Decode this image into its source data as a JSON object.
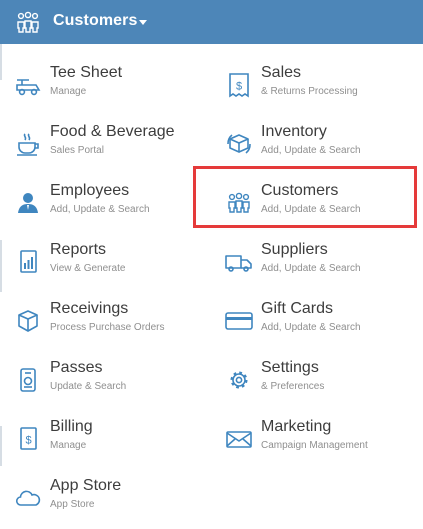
{
  "header": {
    "title": "Customers"
  },
  "menu": {
    "left": [
      {
        "title": "Tee Sheet",
        "subtitle": "Manage",
        "icon": "golf-cart-icon"
      },
      {
        "title": "Food & Beverage",
        "subtitle": "Sales Portal",
        "icon": "coffee-cup-icon"
      },
      {
        "title": "Employees",
        "subtitle": "Add, Update & Search",
        "icon": "employee-icon"
      },
      {
        "title": "Reports",
        "subtitle": "View & Generate",
        "icon": "report-icon"
      },
      {
        "title": "Receivings",
        "subtitle": "Process Purchase Orders",
        "icon": "box-icon"
      },
      {
        "title": "Passes",
        "subtitle": "Update & Search",
        "icon": "pass-icon"
      },
      {
        "title": "Billing",
        "subtitle": "Manage",
        "icon": "billing-icon"
      },
      {
        "title": "App Store",
        "subtitle": "App Store",
        "icon": "cloud-icon"
      }
    ],
    "right": [
      {
        "title": "Sales",
        "subtitle": "& Returns Processing",
        "icon": "receipt-icon"
      },
      {
        "title": "Inventory",
        "subtitle": "Add, Update & Search",
        "icon": "inventory-icon"
      },
      {
        "title": "Customers",
        "subtitle": "Add, Update & Search",
        "icon": "customers-icon"
      },
      {
        "title": "Suppliers",
        "subtitle": "Add, Update & Search",
        "icon": "truck-icon"
      },
      {
        "title": "Gift Cards",
        "subtitle": "Add, Update & Search",
        "icon": "gift-card-icon"
      },
      {
        "title": "Settings",
        "subtitle": "& Preferences",
        "icon": "gear-icon"
      },
      {
        "title": "Marketing",
        "subtitle": "Campaign Management",
        "icon": "envelope-icon"
      }
    ]
  },
  "colors": {
    "header": "#4d86b8",
    "icon": "#3f86bf",
    "highlight": "#e53a3a"
  }
}
